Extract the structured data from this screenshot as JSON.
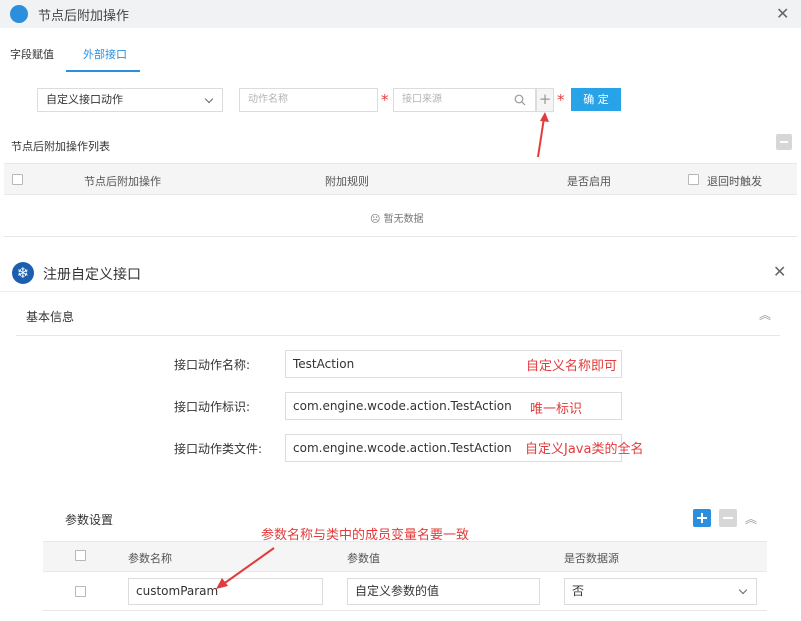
{
  "dialog1": {
    "title": "节点后附加操作",
    "tabs": [
      {
        "label": "字段赋值"
      },
      {
        "label": "外部接口"
      }
    ],
    "action_select": {
      "value": "自定义接口动作"
    },
    "action_name_input": {
      "placeholder": "动作名称"
    },
    "api_source_input": {
      "placeholder": "接口来源"
    },
    "required_mark": "*",
    "plus_label": "+",
    "confirm_label": "确 定",
    "list_title": "节点后附加操作列表",
    "table_headers": {
      "operation": "节点后附加操作",
      "rule": "附加规则",
      "enabled": "是否启用",
      "on_return": "退回时触发"
    },
    "empty_text": "暂无数据",
    "empty_icon": "☹"
  },
  "dialog2": {
    "title": "注册自定义接口",
    "icon": "❄",
    "section_basic": "基本信息",
    "collapse_glyph": "︽",
    "fields": [
      {
        "label": "接口动作名称:",
        "value": "TestAction",
        "note": "自定义名称即可"
      },
      {
        "label": "接口动作标识:",
        "value": "com.engine.wcode.action.TestAction",
        "note": "唯一标识"
      },
      {
        "label": "接口动作类文件:",
        "value": "com.engine.wcode.action.TestAction",
        "note": "自定义Java类的全名"
      }
    ],
    "params_title": "参数设置",
    "params_note": "参数名称与类中的成员变量名要一致",
    "param_headers": {
      "name": "参数名称",
      "value": "参数值",
      "is_datasource": "是否数据源"
    },
    "param_rows": [
      {
        "name": "customParam",
        "value": "自定义参数的值",
        "is_datasource": "否"
      }
    ]
  },
  "close_glyph": "✕",
  "colors": {
    "accent": "#2b8fdd",
    "confirm": "#29a3e8",
    "annotation": "#e23b3b",
    "header_bg": "#f1f2f4"
  }
}
